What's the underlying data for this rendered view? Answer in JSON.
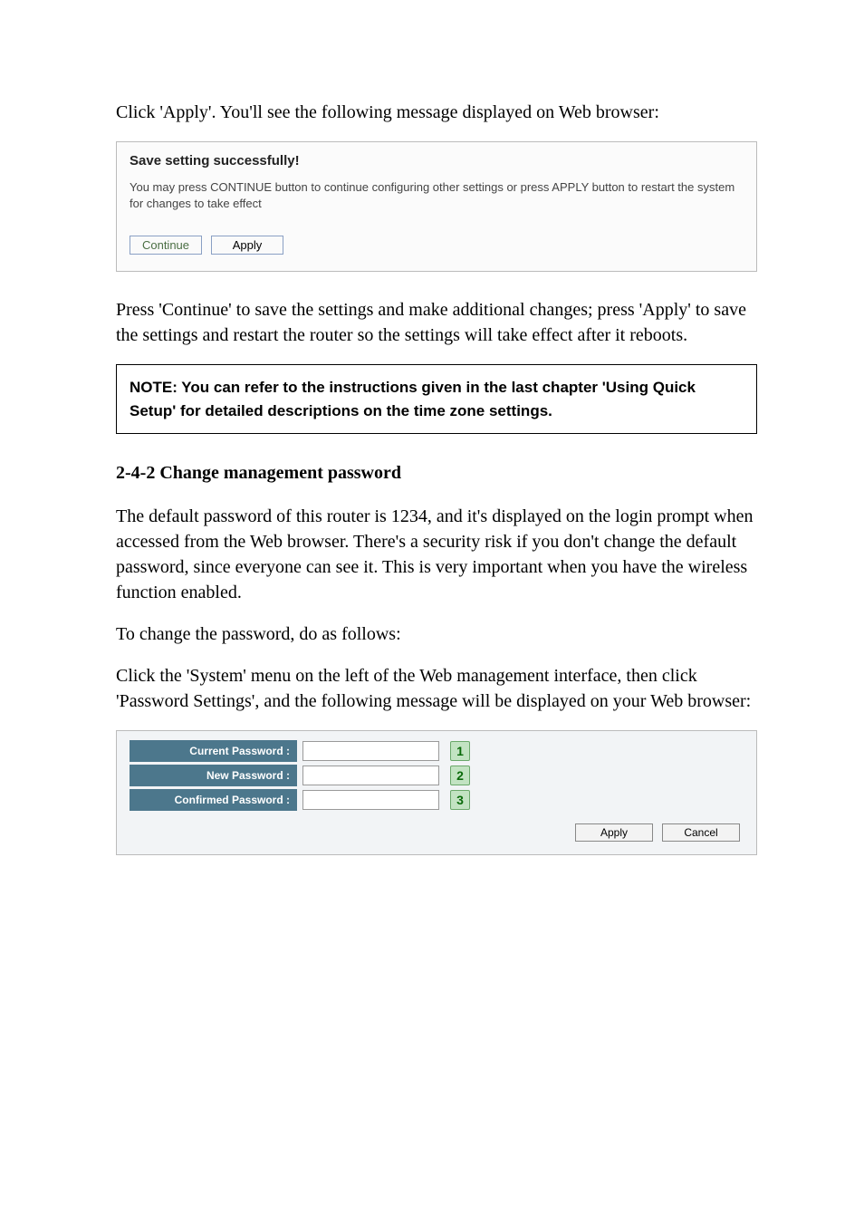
{
  "intro": "Click 'Apply'. You'll see the following message displayed on Web browser:",
  "ui_panel": {
    "heading": "Save setting successfully!",
    "description": "You may press CONTINUE button to continue configuring other settings or press APPLY button to restart the system for changes to take effect",
    "continue_label": "Continue",
    "apply_label": "Apply"
  },
  "post_panel": "Press 'Continue' to save the settings and make additional changes; press 'Apply' to save the settings and restart the router so the settings will take effect after it reboots.",
  "note": "NOTE: You can refer to the instructions given in the last chapter 'Using Quick Setup' for detailed descriptions on the time zone settings.",
  "section_heading": "2-4-2 Change management password",
  "section_para1": "The default password of this router is 1234, and it's displayed on the login prompt when accessed from the Web browser. There's a security risk if you don't change the default password, since everyone can see it. This is very important when you have the wireless function enabled.",
  "section_para2": "To change the password, do as follows:",
  "section_para3": "Click the 'System' menu on the left of the Web management interface, then click 'Password Settings', and the following message will be displayed on your Web browser:",
  "form": {
    "rows": [
      {
        "label": "Current Password :",
        "badge": "1"
      },
      {
        "label": "New Password :",
        "badge": "2"
      },
      {
        "label": "Confirmed Password :",
        "badge": "3"
      }
    ],
    "apply_label": "Apply",
    "cancel_label": "Cancel"
  }
}
